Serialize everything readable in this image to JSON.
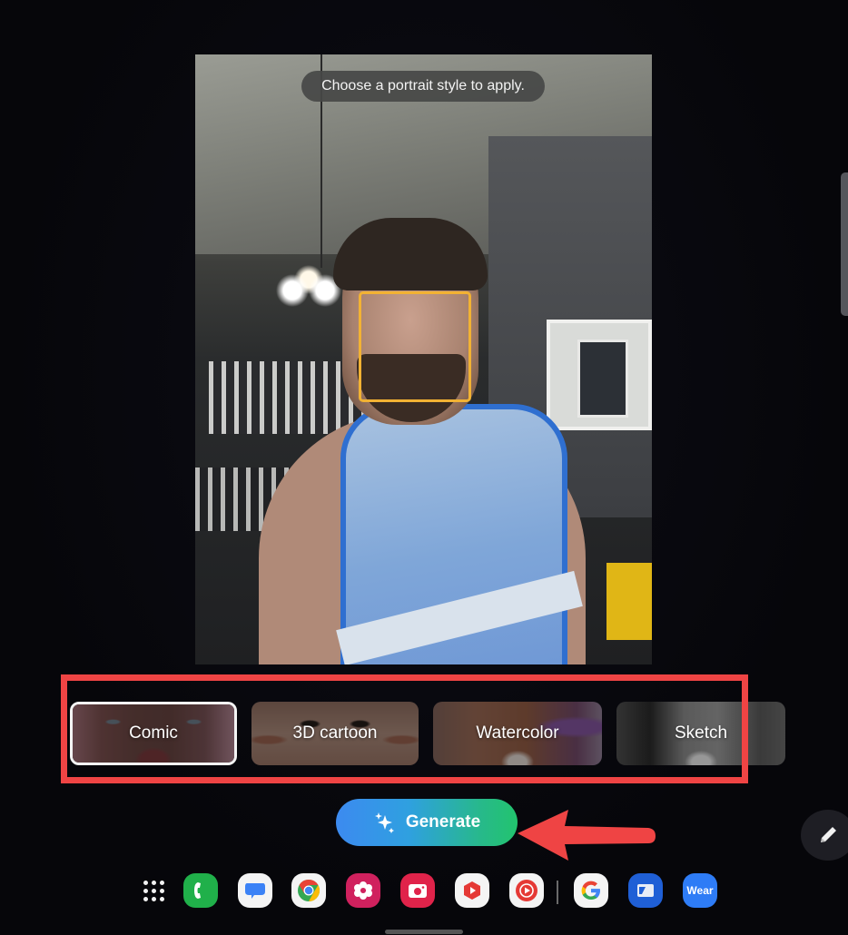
{
  "photo": {
    "hint": "Choose a portrait style to apply.",
    "face_box_color": "#f2b233"
  },
  "styles": {
    "items": [
      {
        "label": "Comic",
        "selected": true
      },
      {
        "label": "3D cartoon",
        "selected": false
      },
      {
        "label": "Watercolor",
        "selected": false
      },
      {
        "label": "Sketch",
        "selected": false
      }
    ],
    "highlight_color": "#ef4444"
  },
  "generate": {
    "label": "Generate",
    "icon": "sparkle-icon"
  },
  "edit_fab": {
    "icon": "pencil-icon"
  },
  "dock": {
    "apps": [
      {
        "name": "app-drawer",
        "icon": "grid-icon"
      },
      {
        "name": "phone",
        "icon": "phone-icon",
        "color": "#20b04a"
      },
      {
        "name": "messages",
        "icon": "chat-bubble-icon",
        "color": "#3b82f6"
      },
      {
        "name": "chrome",
        "icon": "chrome-icon"
      },
      {
        "name": "gallery",
        "icon": "flower-icon",
        "color": "#d0215e"
      },
      {
        "name": "camera",
        "icon": "camera-icon",
        "color": "#e0234a"
      },
      {
        "name": "youtube",
        "icon": "youtube-icon",
        "color": "#e53935"
      },
      {
        "name": "youtube-music",
        "icon": "youtube-music-icon",
        "color": "#e53935"
      },
      {
        "name": "google",
        "icon": "google-g-icon"
      },
      {
        "name": "samsung-notes",
        "icon": "notes-icon",
        "color": "#1f5fd6"
      },
      {
        "name": "galaxy-wearable",
        "icon": "wear-icon",
        "label": "Wear",
        "color": "#2e7cf6"
      }
    ]
  }
}
